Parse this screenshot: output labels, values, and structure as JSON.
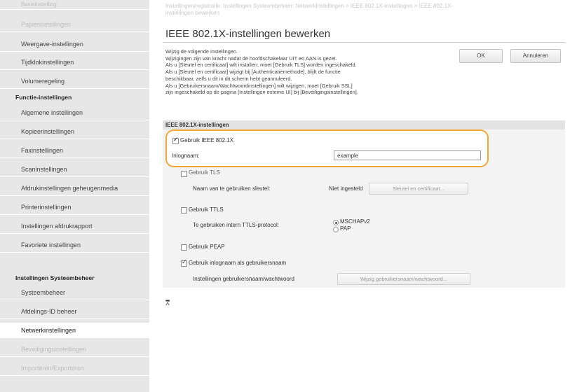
{
  "sidebar": {
    "top_faded": [
      "Basisinstelling",
      "Papierinstellingen"
    ],
    "items": [
      {
        "label": "Weergave-instellingen"
      },
      {
        "label": "Tijdklokinstellingen"
      },
      {
        "label": "Volumeregeling"
      }
    ],
    "section1": "Functie-instellingen",
    "items2": [
      {
        "label": "Algemene instellingen"
      },
      {
        "label": "Kopieerinstellingen"
      },
      {
        "label": "Faxinstellingen"
      },
      {
        "label": "Scaninstellingen"
      },
      {
        "label": "Afdrukinstellingen geheugenmedia"
      },
      {
        "label": "Printerinstellingen"
      },
      {
        "label": "Instellingen afdrukrapport"
      },
      {
        "label": "Favoriete instellingen"
      }
    ],
    "section2": "Instellingen Systeembeheer",
    "items3": [
      {
        "label": "Systeembeheer"
      },
      {
        "label": "Afdelings-ID beheer"
      },
      {
        "label": "Netwerkinstellingen"
      },
      {
        "label": "Beveiligingsinstellingen"
      },
      {
        "label": "Importeren/Exporteren"
      }
    ]
  },
  "breadcrumb": {
    "line1": "Instellingen/registratie: Instellingen Systeembeheer: Netwerkinstellingen > IEEE 802.1X-instellingen > IEEE 802.1X-",
    "line2": "instellingen bewerken"
  },
  "page": {
    "title": "IEEE 802.1X-instellingen bewerken",
    "ok_label": "OK",
    "cancel_label": "Annuleren",
    "description": [
      "Wijzig de volgende instellingen.",
      "Wijzigingen zijn van kracht nadat de hoofdschakelaar UIT en AAN is gezet.",
      "Als u [Sleutel en certificaat] wilt installen, moet [Gebruik TLS] worden ingeschakeld.",
      "Als u [Sleutel en certificaat] wijzigt bij [Authenticatiemethode], blijft de functie",
      "beschikbaar, zelfs u dit in dit scherm hebt geannuleerd.",
      "Als u [Gebruikersnaam/Wachtwoordinstellingen] wilt wijzigen, moet [Gebruik SSL]",
      "zijn ingeschakeld op de pagina [Instellingen externe UI] bij [Beveiligingsinstellingen]."
    ]
  },
  "form": {
    "section_title": "IEEE 802.1X-instellingen",
    "use_ieee_label": "Gebruik IEEE 802.1X",
    "login_name_label": "Inlognaam:",
    "login_name_value": "example",
    "use_tls_label": "Gebruik TLS",
    "key_name_label": "Naam van te gebruiken sleutel:",
    "key_name_value": "Niet ingesteld",
    "key_cert_button": "Sleutel en certificaat...",
    "use_ttls_label": "Gebruik TTLS",
    "ttls_protocol_label": "Te gebruiken intern TTLS-protocol:",
    "protocol_options": [
      "MSCHAPv2",
      "PAP"
    ],
    "use_peap_label": "Gebruik PEAP",
    "use_login_as_user_label": "Gebruik inlognaam als gebruikersnaam",
    "user_pw_settings_label": "Instellingen gebruikersnaam/wachtwoord",
    "change_user_pw_button": "Wijzig gebruikersnaam/wachtwoord..."
  },
  "to_top_icon": "to-top-icon",
  "colors": {
    "highlight": "#f2a634",
    "sidebar_bg": "#e7e7e7"
  }
}
